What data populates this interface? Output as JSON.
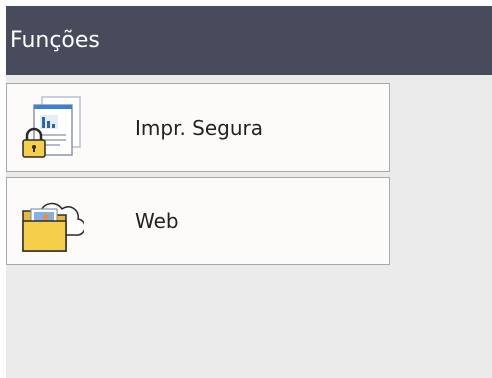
{
  "header": {
    "title": "Funções"
  },
  "items": [
    {
      "label": "Impr. Segura",
      "icon": "secure-print-icon"
    },
    {
      "label": "Web",
      "icon": "web-folder-icon"
    }
  ],
  "colors": {
    "header_bg": "#474b5c",
    "screen_bg": "#ecebeb",
    "item_bg": "#fdfafa",
    "item_border": "#a9a9a9",
    "folder_yellow": "#f6cf4a"
  }
}
